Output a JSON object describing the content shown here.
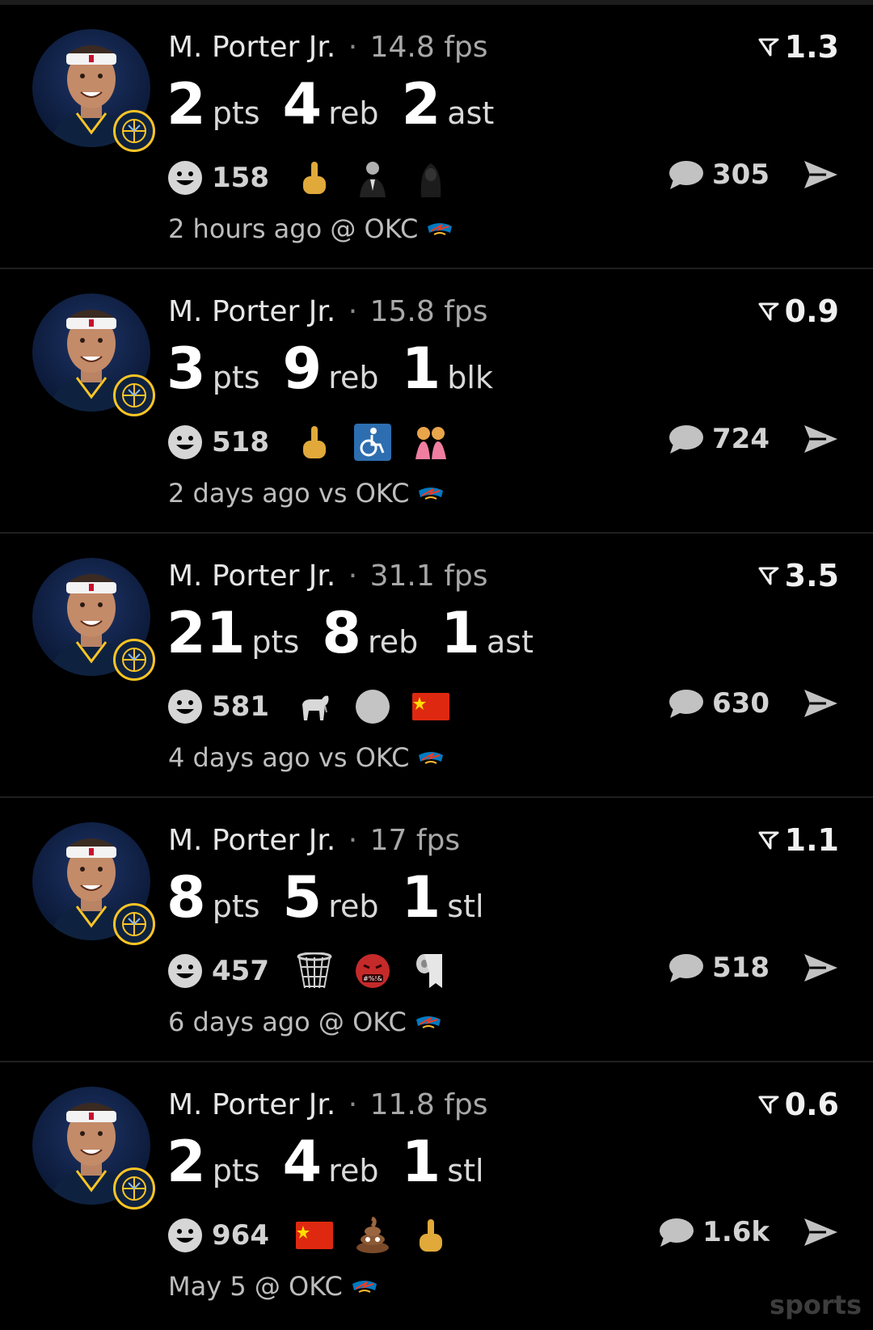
{
  "cards": [
    {
      "player": "M. Porter Jr.",
      "separator": "·",
      "fps": "14.8 fps",
      "rank": "1.3",
      "stats": [
        {
          "num": "2",
          "unit": "pts"
        },
        {
          "num": "4",
          "unit": "reb"
        },
        {
          "num": "2",
          "unit": "ast"
        }
      ],
      "reaction_count": "158",
      "emojis": [
        "middle-finger-emoji",
        "suited-man-emoji",
        "hooded-figure-emoji"
      ],
      "comment_count": "305",
      "meta": "2 hours ago @ OKC"
    },
    {
      "player": "M. Porter Jr.",
      "separator": "·",
      "fps": "15.8 fps",
      "rank": "0.9",
      "stats": [
        {
          "num": "3",
          "unit": "pts"
        },
        {
          "num": "9",
          "unit": "reb"
        },
        {
          "num": "1",
          "unit": "blk"
        }
      ],
      "reaction_count": "518",
      "emojis": [
        "middle-finger-emoji",
        "wheelchair-emoji",
        "two-women-emoji"
      ],
      "comment_count": "724",
      "meta": "2 days ago vs OKC"
    },
    {
      "player": "M. Porter Jr.",
      "separator": "·",
      "fps": "31.1 fps",
      "rank": "3.5",
      "stats": [
        {
          "num": "21",
          "unit": "pts"
        },
        {
          "num": "8",
          "unit": "reb"
        },
        {
          "num": "1",
          "unit": "ast"
        }
      ],
      "reaction_count": "581",
      "emojis": [
        "goat-emoji",
        "grey-circle-emoji",
        "china-flag-emoji"
      ],
      "comment_count": "630",
      "meta": "4 days ago vs OKC"
    },
    {
      "player": "M. Porter Jr.",
      "separator": "·",
      "fps": "17 fps",
      "rank": "1.1",
      "stats": [
        {
          "num": "8",
          "unit": "pts"
        },
        {
          "num": "5",
          "unit": "reb"
        },
        {
          "num": "1",
          "unit": "stl"
        }
      ],
      "reaction_count": "457",
      "emojis": [
        "basketball-net-emoji",
        "cursing-face-emoji",
        "toilet-paper-emoji"
      ],
      "comment_count": "518",
      "meta": "6 days ago @ OKC"
    },
    {
      "player": "M. Porter Jr.",
      "separator": "·",
      "fps": "11.8 fps",
      "rank": "0.6",
      "stats": [
        {
          "num": "2",
          "unit": "pts"
        },
        {
          "num": "4",
          "unit": "reb"
        },
        {
          "num": "1",
          "unit": "stl"
        }
      ],
      "reaction_count": "964",
      "emojis": [
        "china-flag-emoji",
        "poop-emoji",
        "middle-finger-emoji"
      ],
      "comment_count": "1.6k",
      "meta": "May 5 @ OKC"
    }
  ],
  "watermark": "sports",
  "colors": {
    "background": "#000000",
    "divider": "#1f1f1f",
    "nuggets_gold": "#fec524",
    "nuggets_navy": "#0e2240",
    "thunder_blue": "#007ac1"
  }
}
